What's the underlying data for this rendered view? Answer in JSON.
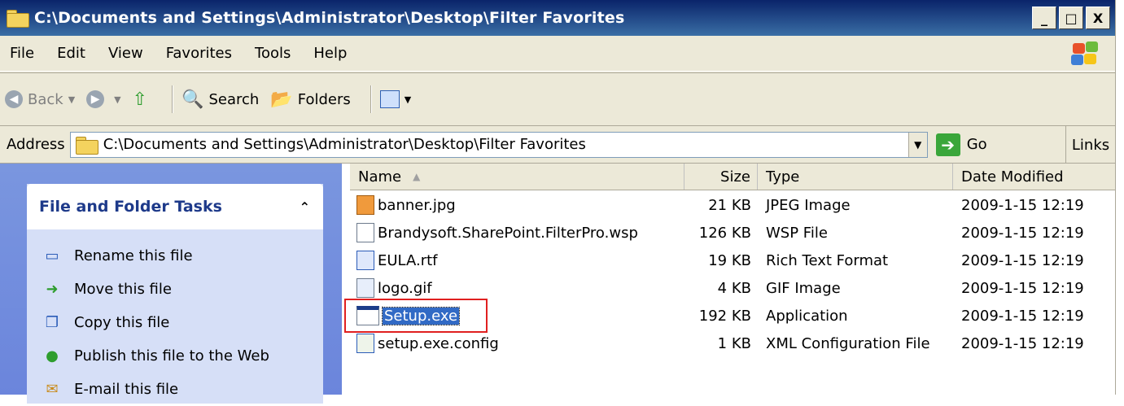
{
  "window": {
    "title": "C:\\Documents and Settings\\Administrator\\Desktop\\Filter Favorites",
    "controls": {
      "minimize": "_",
      "maximize": "□",
      "close": "X"
    }
  },
  "menu": [
    "File",
    "Edit",
    "View",
    "Favorites",
    "Tools",
    "Help"
  ],
  "toolbar": {
    "back_label": "Back",
    "search_label": "Search",
    "folders_label": "Folders"
  },
  "address": {
    "label": "Address",
    "value": "C:\\Documents and Settings\\Administrator\\Desktop\\Filter Favorites",
    "go_label": "Go",
    "links_label": "Links"
  },
  "tasks": {
    "title": "File and Folder Tasks",
    "items": [
      "Rename this file",
      "Move this file",
      "Copy this file",
      "Publish this file to the Web",
      "E-mail this file"
    ]
  },
  "columns": {
    "name": "Name",
    "size": "Size",
    "type": "Type",
    "date": "Date Modified"
  },
  "files": [
    {
      "name": "banner.jpg",
      "size": "21 KB",
      "type": "JPEG Image",
      "date": "2009-1-15 12:19"
    },
    {
      "name": "Brandysoft.SharePoint.FilterPro.wsp",
      "size": "126 KB",
      "type": "WSP File",
      "date": "2009-1-15 12:19"
    },
    {
      "name": "EULA.rtf",
      "size": "19 KB",
      "type": "Rich Text Format",
      "date": "2009-1-15 12:19"
    },
    {
      "name": "logo.gif",
      "size": "4 KB",
      "type": "GIF Image",
      "date": "2009-1-15 12:19"
    },
    {
      "name": "Setup.exe",
      "size": "192 KB",
      "type": "Application",
      "date": "2009-1-15 12:19"
    },
    {
      "name": "setup.exe.config",
      "size": "1 KB",
      "type": "XML Configuration File",
      "date": "2009-1-15 12:19"
    }
  ],
  "colors": {
    "titlebar": "#0a246a",
    "selection": "#316ac5",
    "highlight": "#e02020",
    "task_link": "#215dc6"
  }
}
